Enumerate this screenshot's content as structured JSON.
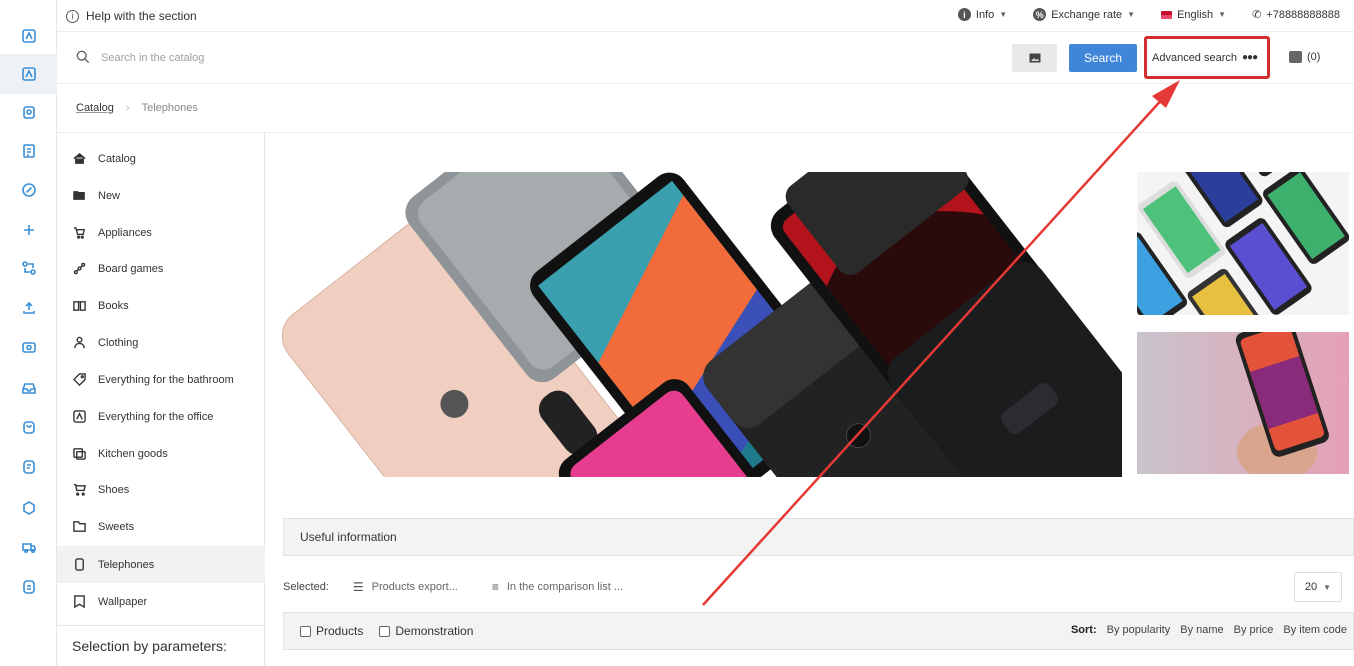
{
  "topbar": {
    "help_label": "Help with the section",
    "info_label": "Info",
    "exchange_label": "Exchange rate",
    "language_label": "English",
    "phone": "+78888888888"
  },
  "search": {
    "placeholder": "Search in the catalog",
    "button_label": "Search",
    "advanced_label": "Advanced search",
    "compare_count": "(0)"
  },
  "breadcrumb": {
    "root": "Catalog",
    "current": "Telephones"
  },
  "categories": [
    {
      "label": "Catalog",
      "icon": "home-icon"
    },
    {
      "label": "New",
      "icon": "folder-open-icon"
    },
    {
      "label": "Appliances",
      "icon": "cart-icon"
    },
    {
      "label": "Board games",
      "icon": "nodes-icon"
    },
    {
      "label": "Books",
      "icon": "book-icon"
    },
    {
      "label": "Clothing",
      "icon": "person-icon"
    },
    {
      "label": "Everything for the bathroom",
      "icon": "tag-icon"
    },
    {
      "label": "Everything for the office",
      "icon": "documents-icon"
    },
    {
      "label": "Kitchen goods",
      "icon": "pot-icon"
    },
    {
      "label": "Shoes",
      "icon": "basket-icon"
    },
    {
      "label": "Sweets",
      "icon": "folder-icon"
    },
    {
      "label": "Telephones",
      "icon": "phone-icon"
    },
    {
      "label": "Wallpaper",
      "icon": "bookmark-icon"
    }
  ],
  "active_category": "Telephones",
  "selection_by_parameters": "Selection by parameters:",
  "useful_info": "Useful information",
  "selected": {
    "label": "Selected:",
    "export_label": "Products export...",
    "comparison_label": "In the comparison list ..."
  },
  "page_size": "20",
  "table_head": {
    "products_label": "Products",
    "demo_label": "Demonstration",
    "sort_label": "Sort:",
    "sort_options": [
      "By popularity",
      "By name",
      "By price",
      "By item code"
    ]
  },
  "colors": {
    "accent": "#3f86d8",
    "highlight": "#d32f2f"
  }
}
